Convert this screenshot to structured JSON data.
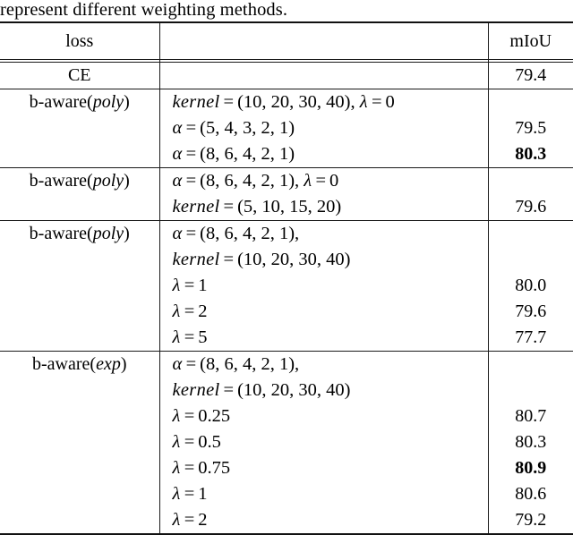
{
  "caption": "represent different weighting methods.",
  "table": {
    "columns": [
      {
        "key": "loss",
        "header": "loss",
        "align": "center"
      },
      {
        "key": "config",
        "header": "",
        "align": "left"
      },
      {
        "key": "miou",
        "header": "mIoU",
        "align": "center"
      }
    ],
    "groups": [
      {
        "loss_text": "CE",
        "loss_italic": "",
        "lines": [],
        "values": [
          {
            "text": "79.4",
            "bold": false
          }
        ]
      },
      {
        "loss_text": "b-aware(",
        "loss_italic": "poly",
        "loss_tail": ")",
        "lines": [
          "kernel = (10, 20, 30, 40), λ = 0",
          "α = (5, 4, 3, 2, 1)",
          "α = (8, 6, 4, 2, 1)"
        ],
        "values": [
          {
            "text": "",
            "bold": false
          },
          {
            "text": "79.5",
            "bold": false
          },
          {
            "text": "80.3",
            "bold": true
          }
        ]
      },
      {
        "loss_text": "b-aware(",
        "loss_italic": "poly",
        "loss_tail": ")",
        "lines": [
          "α = (8, 6, 4, 2, 1), λ = 0",
          "kernel = (5, 10, 15, 20)"
        ],
        "values": [
          {
            "text": "",
            "bold": false
          },
          {
            "text": "79.6",
            "bold": false
          }
        ]
      },
      {
        "loss_text": "b-aware(",
        "loss_italic": "poly",
        "loss_tail": ")",
        "lines": [
          "α = (8, 6, 4, 2, 1),",
          "kernel = (10, 20, 30, 40)",
          "λ = 1",
          "λ = 2",
          "λ = 5"
        ],
        "values": [
          {
            "text": "",
            "bold": false
          },
          {
            "text": "",
            "bold": false
          },
          {
            "text": "80.0",
            "bold": false
          },
          {
            "text": "79.6",
            "bold": false
          },
          {
            "text": "77.7",
            "bold": false
          }
        ]
      },
      {
        "loss_text": "b-aware(",
        "loss_italic": "exp",
        "loss_tail": ")",
        "lines": [
          "α = (8, 6, 4, 2, 1),",
          "kernel = (10, 20, 30, 40)",
          "λ = 0.25",
          "λ = 0.5",
          "λ = 0.75",
          "λ = 1",
          "λ = 2"
        ],
        "values": [
          {
            "text": "",
            "bold": false
          },
          {
            "text": "",
            "bold": false
          },
          {
            "text": "80.7",
            "bold": false
          },
          {
            "text": "80.3",
            "bold": false
          },
          {
            "text": "80.9",
            "bold": true
          },
          {
            "text": "80.6",
            "bold": false
          },
          {
            "text": "79.2",
            "bold": false
          }
        ]
      }
    ]
  },
  "math": {
    "g1": {
      "l1": {
        "fn": "kernel",
        "eq": "=",
        "args": "(10, 20, 30, 40),",
        "lam": "λ",
        "eq2": "=",
        "lamval": "0"
      },
      "l2": {
        "sym": "α",
        "eq": "=",
        "args": "(5, 4, 3, 2, 1)"
      },
      "l3": {
        "sym": "α",
        "eq": "=",
        "args": "(8, 6, 4, 2, 1)"
      }
    },
    "g2": {
      "l1": {
        "sym": "α",
        "eq": "=",
        "args": "(8, 6, 4, 2, 1),",
        "lam": "λ",
        "eq2": "=",
        "lamval": "0"
      },
      "l2": {
        "fn": "kernel",
        "eq": "=",
        "args": "(5, 10, 15, 20)"
      }
    },
    "g3": {
      "l1": {
        "sym": "α",
        "eq": "=",
        "args": "(8, 6, 4, 2, 1),"
      },
      "l2": {
        "fn": "kernel",
        "eq": "=",
        "args": "(10, 20, 30, 40)"
      },
      "l3": {
        "lam": "λ",
        "eq": "=",
        "lamval": "1"
      },
      "l4": {
        "lam": "λ",
        "eq": "=",
        "lamval": "2"
      },
      "l5": {
        "lam": "λ",
        "eq": "=",
        "lamval": "5"
      }
    },
    "g4": {
      "l1": {
        "sym": "α",
        "eq": "=",
        "args": "(8, 6, 4, 2, 1),"
      },
      "l2": {
        "fn": "kernel",
        "eq": "=",
        "args": "(10, 20, 30, 40)"
      },
      "l3": {
        "lam": "λ",
        "eq": "=",
        "lamval": "0.25"
      },
      "l4": {
        "lam": "λ",
        "eq": "=",
        "lamval": "0.5"
      },
      "l5": {
        "lam": "λ",
        "eq": "=",
        "lamval": "0.75"
      },
      "l6": {
        "lam": "λ",
        "eq": "=",
        "lamval": "1"
      },
      "l7": {
        "lam": "λ",
        "eq": "=",
        "lamval": "2"
      }
    }
  }
}
